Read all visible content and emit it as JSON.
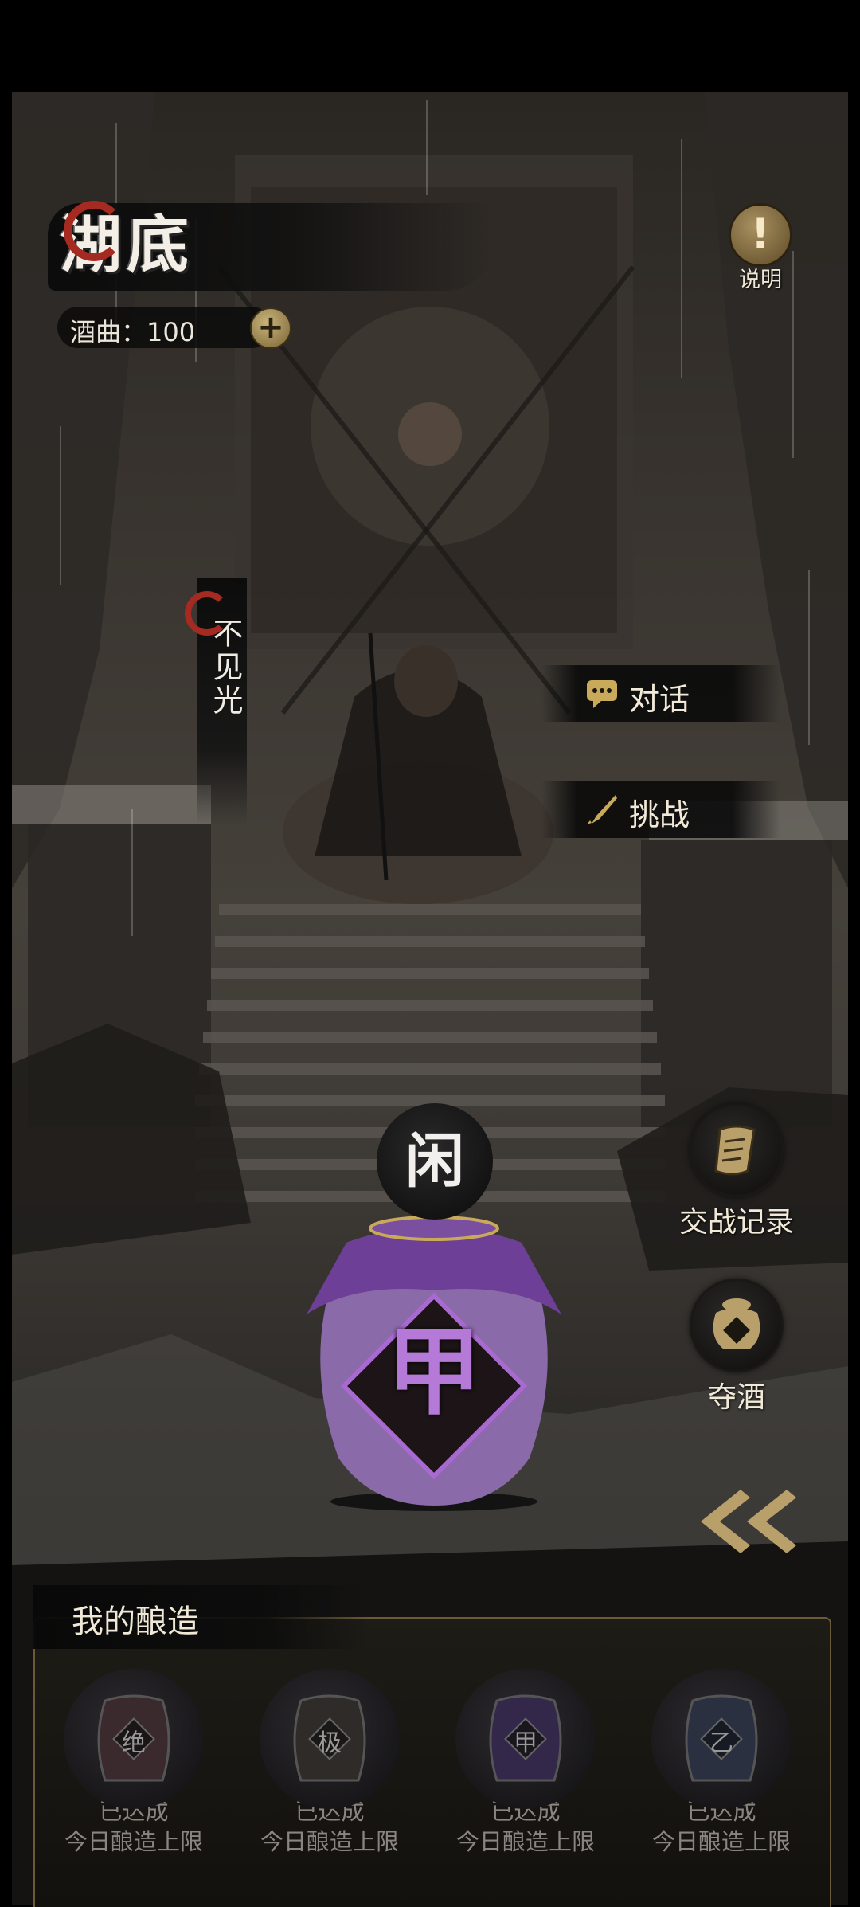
{
  "header": {
    "location_title": "湖底",
    "currency_label": "酒曲：100",
    "add_symbol": "+",
    "help_symbol": "!",
    "help_label": "说明"
  },
  "npc": {
    "name": "不见光"
  },
  "actions": {
    "talk_label": "对话",
    "challenge_label": "挑战"
  },
  "side_buttons": {
    "battle_log_label": "交战记录",
    "seize_wine_label": "夺酒"
  },
  "jar": {
    "status": "闲",
    "grade": "甲",
    "color": "#7a4fa0"
  },
  "brewing": {
    "title": "我的酿造",
    "slots": [
      {
        "grade": "绝",
        "status": "已达成",
        "limit": "今日酿造上限",
        "tint": "#3a2a2e"
      },
      {
        "grade": "极",
        "status": "已达成",
        "limit": "今日酿造上限",
        "tint": "#2e2b29"
      },
      {
        "grade": "甲",
        "status": "已达成",
        "limit": "今日酿造上限",
        "tint": "#33284a"
      },
      {
        "grade": "乙",
        "status": "已达成",
        "limit": "今日酿造上限",
        "tint": "#2a3040"
      }
    ]
  },
  "colors": {
    "accent_red": "#a52a21",
    "gold": "#c8b37a",
    "text_light": "#f2ead8",
    "text_dim": "#8a8580"
  }
}
